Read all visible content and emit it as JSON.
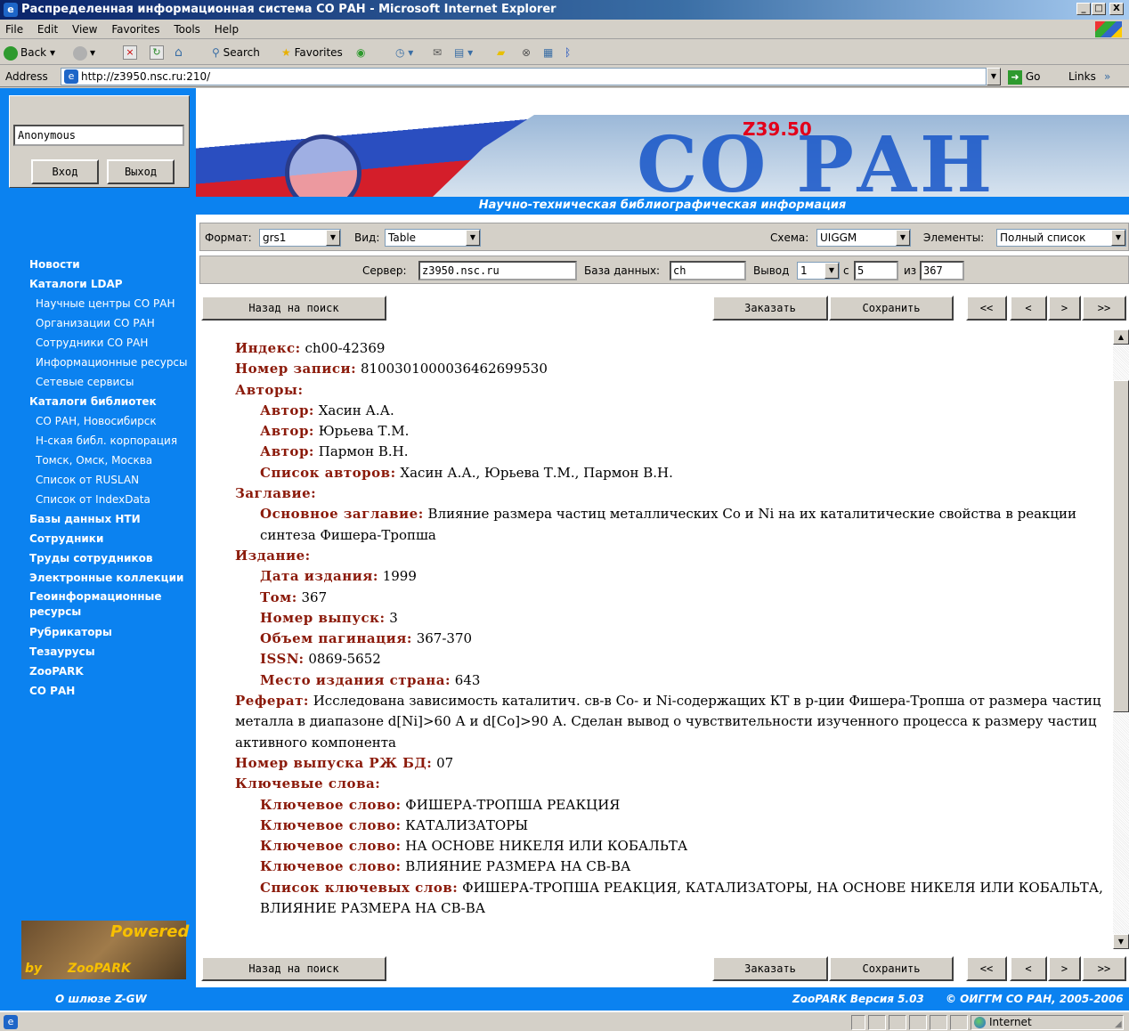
{
  "window": {
    "title": "Распределенная информационная система СО РАН - Microsoft Internet Explorer",
    "controls": [
      "_",
      "□",
      "X"
    ]
  },
  "menu": [
    "File",
    "Edit",
    "View",
    "Favorites",
    "Tools",
    "Help"
  ],
  "toolbar": {
    "back": "Back",
    "search": "Search",
    "favorites": "Favorites"
  },
  "address": {
    "label": "Address",
    "url": "http://z3950.nsc.ru:210/",
    "go": "Go",
    "links": "Links"
  },
  "login": {
    "username": "Anonymous",
    "login_button": "Вход",
    "logout_button": "Выход"
  },
  "banner": {
    "title": "СО РАН",
    "badge": "Z39.50",
    "subtitle": "Научно-техническая библиографическая информация"
  },
  "nav": [
    {
      "label": "Новости",
      "sub": false
    },
    {
      "label": "Каталоги LDAP",
      "sub": false
    },
    {
      "label": "Научные центры СО РАН",
      "sub": true
    },
    {
      "label": "Организации СО РАН",
      "sub": true
    },
    {
      "label": "Сотрудники СО РАН",
      "sub": true
    },
    {
      "label": "Информационные ресурсы",
      "sub": true
    },
    {
      "label": "Сетевые сервисы",
      "sub": true
    },
    {
      "label": "Каталоги библиотек",
      "sub": false
    },
    {
      "label": "СО РАН,  Новосибирск",
      "sub": true
    },
    {
      "label": "Н-ская библ. корпорация",
      "sub": true
    },
    {
      "label": "Томск, Омск, Москва",
      "sub": true
    },
    {
      "label": "Список от RUSLAN",
      "sub": true
    },
    {
      "label": "Список от IndexData",
      "sub": true
    },
    {
      "label": "Базы данных НТИ",
      "sub": false
    },
    {
      "label": "Сотрудники",
      "sub": false
    },
    {
      "label": "Труды сотрудников",
      "sub": false
    },
    {
      "label": "Электронные коллекции",
      "sub": false
    },
    {
      "label": "Геоинформационные ресурсы",
      "sub": false
    },
    {
      "label": "Рубрикаторы",
      "sub": false
    },
    {
      "label": "Тезаурусы",
      "sub": false
    },
    {
      "label": "ZooPARK",
      "sub": false
    },
    {
      "label": "СО РАН",
      "sub": false
    }
  ],
  "filters": {
    "format_label": "Формат:",
    "format_value": "grs1",
    "view_label": "Вид:",
    "view_value": "Table",
    "schema_label": "Схема:",
    "schema_value": "UIGGM",
    "elements_label": "Элементы:",
    "elements_value": "Полный список"
  },
  "server": {
    "server_label": "Сервер:",
    "server_value": "z3950.nsc.ru",
    "db_label": "База данных:",
    "db_value": "ch",
    "output_label": "Вывод",
    "output_value": "1",
    "from_label": "с",
    "from_value": "5",
    "of_label": "из",
    "of_value": "367"
  },
  "actions": {
    "back_to_search": "Назад на поиск",
    "order": "Заказать",
    "save": "Сохранить",
    "first": "<<",
    "prev": "<",
    "next": ">",
    "last": ">>"
  },
  "record": {
    "index_label": "Индекс:",
    "index_value": "ch00-42369",
    "recno_label": "Номер записи:",
    "recno_value": "8100301000036462699530",
    "authors_label": "Авторы:",
    "author_label": "Автор:",
    "authors": [
      "Хасин А.А.",
      "Юрьева Т.М.",
      "Пармон В.Н."
    ],
    "authors_list_label": "Список авторов:",
    "authors_list_value": "Хасин А.А., Юрьева Т.М., Пармон В.Н.",
    "title_label": "Заглавие:",
    "main_title_label": "Основное заглавие:",
    "main_title_value": "Влияние размера частиц металлических Со и Ni на их каталитические свойства в реакции синтеза Фишера-Тропша",
    "edition_label": "Издание:",
    "date_label": "Дата издания:",
    "date_value": "1999",
    "volume_label": "Том:",
    "volume_value": "367",
    "issue_label": "Номер выпуск:",
    "issue_value": "3",
    "pages_label": "Объем пагинация:",
    "pages_value": "367-370",
    "issn_label": "ISSN:",
    "issn_value": "0869-5652",
    "place_label": "Место издания страна:",
    "place_value": "643",
    "abstract_label": "Реферат:",
    "abstract_value": "Исследована зависимость каталитич. св-в Со- и Ni-содержащих КТ в р-ции Фишера-Тропша от размера частиц металла в диапазоне d[Ni]>60 А и d[Co]>90 А. Сделан вывод о чувствительности изученного процесса к размеру частиц активного компонента",
    "rj_label": "Номер выпуска РЖ БД:",
    "rj_value": "07",
    "keywords_label": "Ключевые слова:",
    "keyword_label": "Ключевое слово:",
    "keywords": [
      "ФИШЕРА-ТРОПША РЕАКЦИЯ",
      "КАТАЛИЗАТОРЫ",
      "НА ОСНОВЕ НИКЕЛЯ ИЛИ КОБАЛЬТА",
      "ВЛИЯНИЕ РАЗМЕРА НА СВ-ВА"
    ],
    "keywords_list_label": "Список ключевых слов:",
    "keywords_list_value": "ФИШЕРА-ТРОПША РЕАКЦИЯ, КАТАЛИЗАТОРЫ, НА ОСНОВЕ НИКЕЛЯ ИЛИ КОБАЛЬТА, ВЛИЯНИЕ РАЗМЕРА НА СВ-ВА"
  },
  "powered": {
    "text1": "Powered",
    "text2": "by",
    "text3": "ZooPARK"
  },
  "footer": {
    "left": "О шлюзе Z-GW",
    "version": "ZooPARK Версия 5.03",
    "copyright": "© ОИГГМ СО РАН, 2005-2006"
  },
  "status": {
    "zone": "Internet"
  },
  "colors": {
    "accent": "#0b82f0",
    "field_label": "#8b1a0a",
    "banner_text": "#1655c8",
    "badge": "#e2001a"
  }
}
